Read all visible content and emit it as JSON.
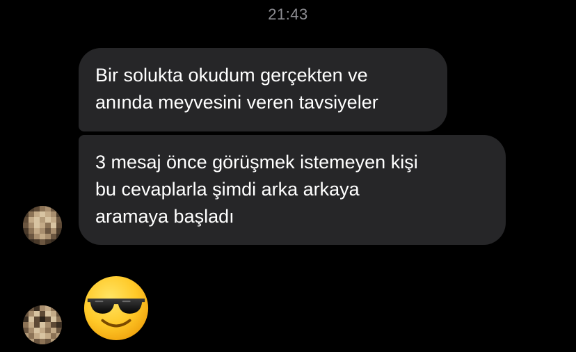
{
  "chat": {
    "timestamp": "21:43",
    "messages": [
      {
        "lines": [
          "Bir solukta okudum gerçekten ve",
          "anında meyvesini veren tavsiyeler"
        ]
      },
      {
        "lines": [
          "3 mesaj önce görüşmek istemeyen kişi",
          "bu cevaplarla şimdi arka arkaya",
          "aramaya başladı"
        ]
      }
    ],
    "emoji": "smiling-face-with-sunglasses",
    "avatar": "blurred-contact-avatar"
  },
  "colors": {
    "background": "#000000",
    "bubble": "#262628",
    "timestamp": "#8e8e93",
    "text": "#ffffff"
  }
}
